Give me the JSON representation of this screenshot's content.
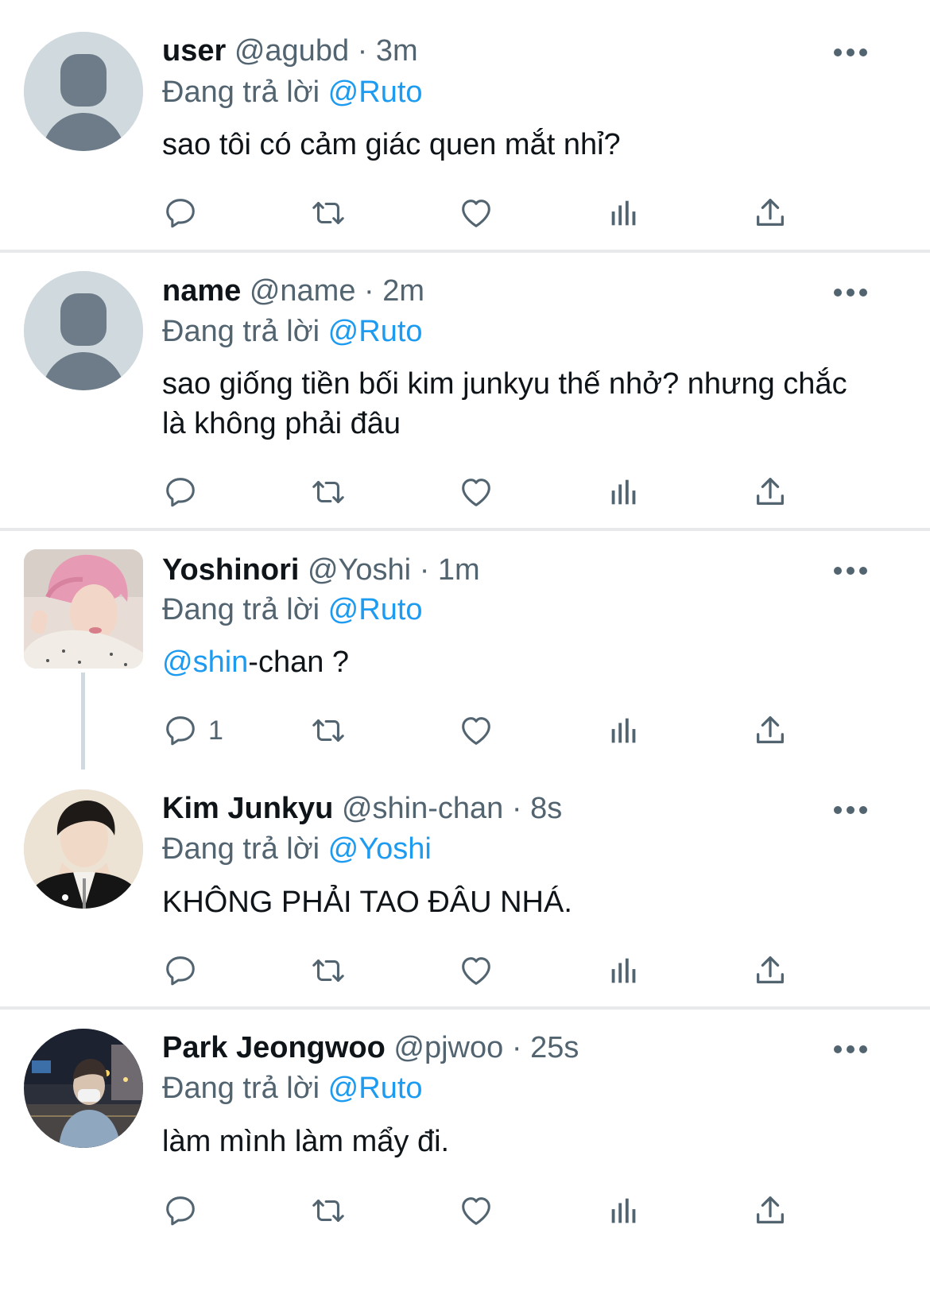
{
  "reply_prefix": "Đang trả lời",
  "tweets": [
    {
      "name": "user",
      "handle": "@agubd",
      "time": "3m",
      "replying_to": "@Ruto",
      "text": "sao tôi có cảm giác quen mắt nhỉ?",
      "reply_count": "",
      "avatar": "default-avatar"
    },
    {
      "name": "name",
      "handle": "@name",
      "time": "2m",
      "replying_to": "@Ruto",
      "text": "sao giống tiền bối kim junkyu thế nhở? nhưng chắc là không phải đâu",
      "reply_count": "",
      "avatar": "default-avatar"
    },
    {
      "name": "Yoshinori",
      "handle": "@Yoshi",
      "time": "1m",
      "replying_to": "@Ruto",
      "text_mention": "@shin",
      "text_rest": "-chan ?",
      "reply_count": "1",
      "avatar": "photo-pink-hair"
    },
    {
      "name": "Kim Junkyu",
      "handle": "@shin-chan",
      "time": "8s",
      "replying_to": "@Yoshi",
      "text": "KHÔNG PHẢI TAO ĐÂU NHÁ.",
      "reply_count": "",
      "avatar": "photo-dark-hair"
    },
    {
      "name": "Park Jeongwoo",
      "handle": "@pjwoo",
      "time": "25s",
      "replying_to": "@Ruto",
      "text": "làm mình làm mẩy đi.",
      "reply_count": "",
      "avatar": "photo-night-street"
    }
  ],
  "separator": "·",
  "icons": [
    "reply-icon",
    "retweet-icon",
    "like-icon",
    "analytics-icon",
    "share-icon",
    "more-icon"
  ],
  "colors": {
    "link": "#1d9bf0",
    "secondary": "#536471",
    "divider": "#e7e9eb"
  }
}
